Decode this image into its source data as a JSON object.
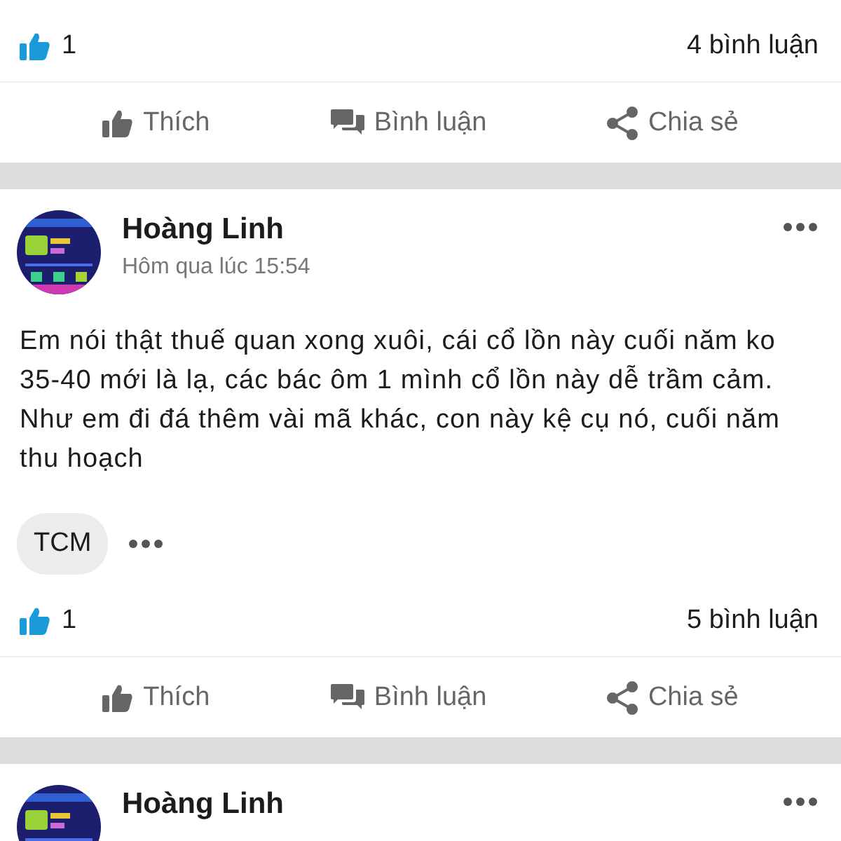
{
  "posts": [
    {
      "stats": {
        "likes": "1",
        "comments": "4 bình luận"
      },
      "actions": [
        {
          "kind": "like",
          "label": "Thích"
        },
        {
          "kind": "comment",
          "label": "Bình luận"
        },
        {
          "kind": "share",
          "label": "Chia sẻ"
        }
      ]
    },
    {
      "author": "Hoàng Linh",
      "time": "Hôm qua lúc 15:54",
      "text": "Em nói thật thuế quan xong xuôi, cái cổ lồn này cuối năm ko 35-40 mới là lạ, các bác ôm 1 mình cổ lồn này dễ trầm cảm. Như em đi đá thêm vài mã khác, con này kệ cụ nó, cuối năm thu hoạch",
      "tags": [
        "TCM"
      ],
      "stats": {
        "likes": "1",
        "comments": "5 bình luận"
      },
      "actions": [
        {
          "kind": "like",
          "label": "Thích"
        },
        {
          "kind": "comment",
          "label": "Bình luận"
        },
        {
          "kind": "share",
          "label": "Chia sẻ"
        }
      ]
    },
    {
      "author": "Hoàng Linh"
    }
  ]
}
